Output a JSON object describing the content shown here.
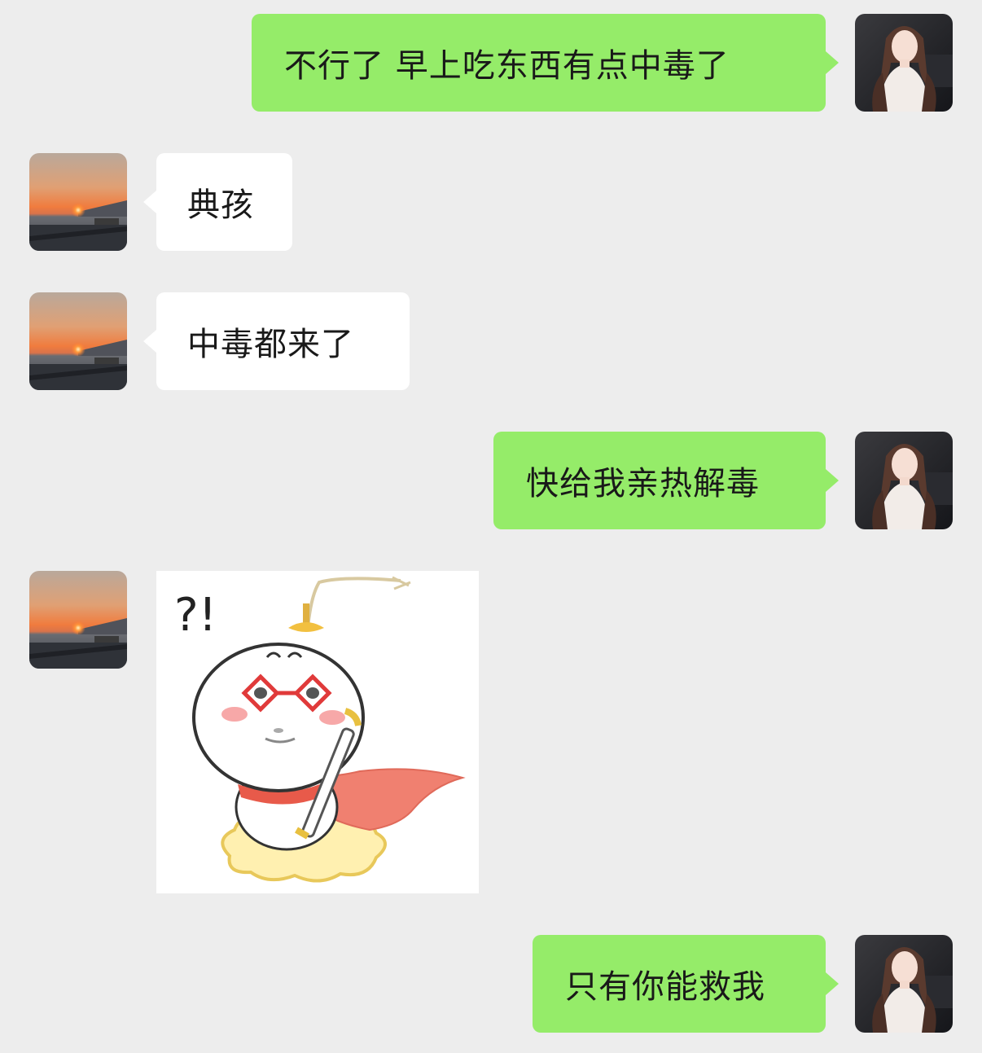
{
  "messages": [
    {
      "id": "m1",
      "direction": "out",
      "type": "text",
      "text": "不行了 早上吃东西有点中毒了",
      "avatar": "girl-avatar"
    },
    {
      "id": "m2",
      "direction": "in",
      "type": "text",
      "text": "典孩",
      "avatar": "sunset-avatar"
    },
    {
      "id": "m3",
      "direction": "in",
      "type": "text",
      "text": "中毒都来了",
      "avatar": "sunset-avatar"
    },
    {
      "id": "m4",
      "direction": "out",
      "type": "text",
      "text": "快给我亲热解毒",
      "avatar": "girl-avatar"
    },
    {
      "id": "m5",
      "direction": "in",
      "type": "sticker",
      "sticker_text": "?!",
      "sticker": "superhero-bun-sticker",
      "avatar": "sunset-avatar"
    },
    {
      "id": "m6",
      "direction": "out",
      "type": "text",
      "text": "只有你能救我",
      "avatar": "girl-avatar"
    }
  ],
  "colors": {
    "background": "#ededed",
    "outgoing_bubble": "#95ec69",
    "incoming_bubble": "#ffffff",
    "text": "#191919"
  }
}
